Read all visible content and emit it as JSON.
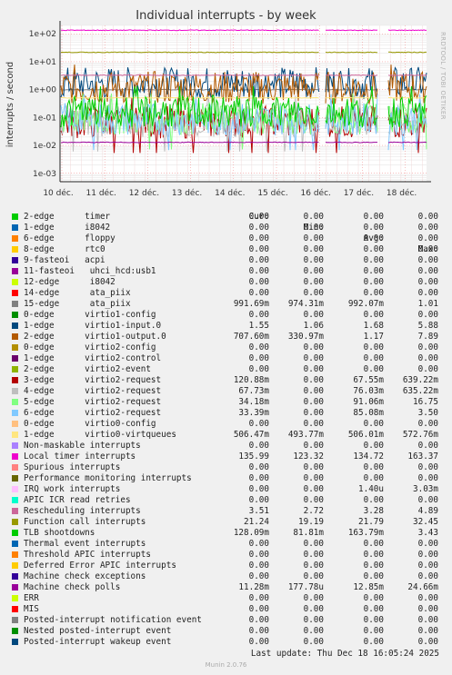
{
  "chart_data": {
    "type": "line",
    "title": "Individual interrupts - by week",
    "ylabel": "interrupts / second",
    "yscale": "log",
    "ylim": [
      0.0005,
      200
    ],
    "yticks": [
      "1e-03",
      "1e-02",
      "1e-01",
      "1e+00",
      "1e+01",
      "1e+02"
    ],
    "xlabels": [
      "10 déc.",
      "11 déc.",
      "12 déc.",
      "13 déc.",
      "14 déc.",
      "15 déc.",
      "16 déc.",
      "17 déc.",
      "18 déc."
    ],
    "columns": [
      "Cur:",
      "Min:",
      "Avg:",
      "Max:"
    ],
    "series": [
      {
        "name": "2-edge      timer",
        "color": "#00cc00",
        "cur": "0.00",
        "min": "0.00",
        "avg": "0.00",
        "max": "0.00"
      },
      {
        "name": "1-edge      i8042",
        "color": "#0066b3",
        "cur": "0.00",
        "min": "0.00",
        "avg": "0.00",
        "max": "0.00"
      },
      {
        "name": "6-edge      floppy",
        "color": "#ff8000",
        "cur": "0.00",
        "min": "0.00",
        "avg": "0.00",
        "max": "0.00"
      },
      {
        "name": "8-edge      rtc0",
        "color": "#ffcc00",
        "cur": "0.00",
        "min": "0.00",
        "avg": "0.00",
        "max": "0.00"
      },
      {
        "name": "9-fasteoi   acpi",
        "color": "#330099",
        "cur": "0.00",
        "min": "0.00",
        "avg": "0.00",
        "max": "0.00"
      },
      {
        "name": "11-fasteoi   uhci_hcd:usb1",
        "color": "#990099",
        "cur": "0.00",
        "min": "0.00",
        "avg": "0.00",
        "max": "0.00"
      },
      {
        "name": "12-edge      i8042",
        "color": "#ccff00",
        "cur": "0.00",
        "min": "0.00",
        "avg": "0.00",
        "max": "0.00"
      },
      {
        "name": "14-edge      ata_piix",
        "color": "#ff0000",
        "cur": "0.00",
        "min": "0.00",
        "avg": "0.00",
        "max": "0.00"
      },
      {
        "name": "15-edge      ata_piix",
        "color": "#808080",
        "cur": "991.69m",
        "min": "974.31m",
        "avg": "992.07m",
        "max": "1.01"
      },
      {
        "name": "0-edge      virtio1-config",
        "color": "#008f00",
        "cur": "0.00",
        "min": "0.00",
        "avg": "0.00",
        "max": "0.00"
      },
      {
        "name": "1-edge      virtio1-input.0",
        "color": "#00487d",
        "cur": "1.55",
        "min": "1.06",
        "avg": "1.68",
        "max": "5.88"
      },
      {
        "name": "2-edge      virtio1-output.0",
        "color": "#b35a00",
        "cur": "707.60m",
        "min": "330.97m",
        "avg": "1.17",
        "max": "7.89"
      },
      {
        "name": "0-edge      virtio2-config",
        "color": "#b38f00",
        "cur": "0.00",
        "min": "0.00",
        "avg": "0.00",
        "max": "0.00"
      },
      {
        "name": "1-edge      virtio2-control",
        "color": "#6b006b",
        "cur": "0.00",
        "min": "0.00",
        "avg": "0.00",
        "max": "0.00"
      },
      {
        "name": "2-edge      virtio2-event",
        "color": "#8fb300",
        "cur": "0.00",
        "min": "0.00",
        "avg": "0.00",
        "max": "0.00"
      },
      {
        "name": "3-edge      virtio2-request",
        "color": "#b30000",
        "cur": "120.88m",
        "min": "0.00",
        "avg": "67.55m",
        "max": "639.22m"
      },
      {
        "name": "4-edge      virtio2-request",
        "color": "#bebebe",
        "cur": "67.73m",
        "min": "0.00",
        "avg": "76.03m",
        "max": "635.22m"
      },
      {
        "name": "5-edge      virtio2-request",
        "color": "#80ff80",
        "cur": "34.18m",
        "min": "0.00",
        "avg": "91.06m",
        "max": "16.75"
      },
      {
        "name": "6-edge      virtio2-request",
        "color": "#80c9ff",
        "cur": "33.39m",
        "min": "0.00",
        "avg": "85.08m",
        "max": "3.50"
      },
      {
        "name": "0-edge      virtio0-config",
        "color": "#ffc080",
        "cur": "0.00",
        "min": "0.00",
        "avg": "0.00",
        "max": "0.00"
      },
      {
        "name": "1-edge      virtio0-virtqueues",
        "color": "#ffe680",
        "cur": "506.47m",
        "min": "493.77m",
        "avg": "506.01m",
        "max": "572.76m"
      },
      {
        "name": "Non-maskable interrupts",
        "color": "#aa80ff",
        "cur": "0.00",
        "min": "0.00",
        "avg": "0.00",
        "max": "0.00"
      },
      {
        "name": "Local timer interrupts",
        "color": "#ee00cc",
        "cur": "135.99",
        "min": "123.32",
        "avg": "134.72",
        "max": "163.37"
      },
      {
        "name": "Spurious interrupts",
        "color": "#ff8080",
        "cur": "0.00",
        "min": "0.00",
        "avg": "0.00",
        "max": "0.00"
      },
      {
        "name": "Performance monitoring interrupts",
        "color": "#666600",
        "cur": "0.00",
        "min": "0.00",
        "avg": "0.00",
        "max": "0.00"
      },
      {
        "name": "IRQ work interrupts",
        "color": "#ffbfff",
        "cur": "0.00",
        "min": "0.00",
        "avg": "1.40u",
        "max": "3.03m"
      },
      {
        "name": "APIC ICR read retries",
        "color": "#00ffcc",
        "cur": "0.00",
        "min": "0.00",
        "avg": "0.00",
        "max": "0.00"
      },
      {
        "name": "Rescheduling interrupts",
        "color": "#cc6699",
        "cur": "3.51",
        "min": "2.72",
        "avg": "3.28",
        "max": "4.89"
      },
      {
        "name": "Function call interrupts",
        "color": "#999900",
        "cur": "21.24",
        "min": "19.19",
        "avg": "21.79",
        "max": "32.45"
      },
      {
        "name": "TLB shootdowns",
        "color": "#00cc00",
        "cur": "128.09m",
        "min": "81.81m",
        "avg": "163.79m",
        "max": "3.43"
      },
      {
        "name": "Thermal event interrupts",
        "color": "#0066b3",
        "cur": "0.00",
        "min": "0.00",
        "avg": "0.00",
        "max": "0.00"
      },
      {
        "name": "Threshold APIC interrupts",
        "color": "#ff8000",
        "cur": "0.00",
        "min": "0.00",
        "avg": "0.00",
        "max": "0.00"
      },
      {
        "name": "Deferred Error APIC interrupts",
        "color": "#ffcc00",
        "cur": "0.00",
        "min": "0.00",
        "avg": "0.00",
        "max": "0.00"
      },
      {
        "name": "Machine check exceptions",
        "color": "#330099",
        "cur": "0.00",
        "min": "0.00",
        "avg": "0.00",
        "max": "0.00"
      },
      {
        "name": "Machine check polls",
        "color": "#990099",
        "cur": "11.28m",
        "min": "177.78u",
        "avg": "12.85m",
        "max": "24.66m"
      },
      {
        "name": "ERR",
        "color": "#ccff00",
        "cur": "0.00",
        "min": "0.00",
        "avg": "0.00",
        "max": "0.00"
      },
      {
        "name": "MIS",
        "color": "#ff0000",
        "cur": "0.00",
        "min": "0.00",
        "avg": "0.00",
        "max": "0.00"
      },
      {
        "name": "Posted-interrupt notification event",
        "color": "#808080",
        "cur": "0.00",
        "min": "0.00",
        "avg": "0.00",
        "max": "0.00"
      },
      {
        "name": "Nested posted-interrupt event",
        "color": "#008f00",
        "cur": "0.00",
        "min": "0.00",
        "avg": "0.00",
        "max": "0.00"
      },
      {
        "name": "Posted-interrupt wakeup event",
        "color": "#00487d",
        "cur": "0.00",
        "min": "0.00",
        "avg": "0.00",
        "max": "0.00"
      }
    ]
  },
  "last_update": "Last update: Thu Dec 18 16:05:24 2025",
  "footer": "Munin 2.0.76",
  "side_label": "RRDTOOL / TOBI OETIKER"
}
